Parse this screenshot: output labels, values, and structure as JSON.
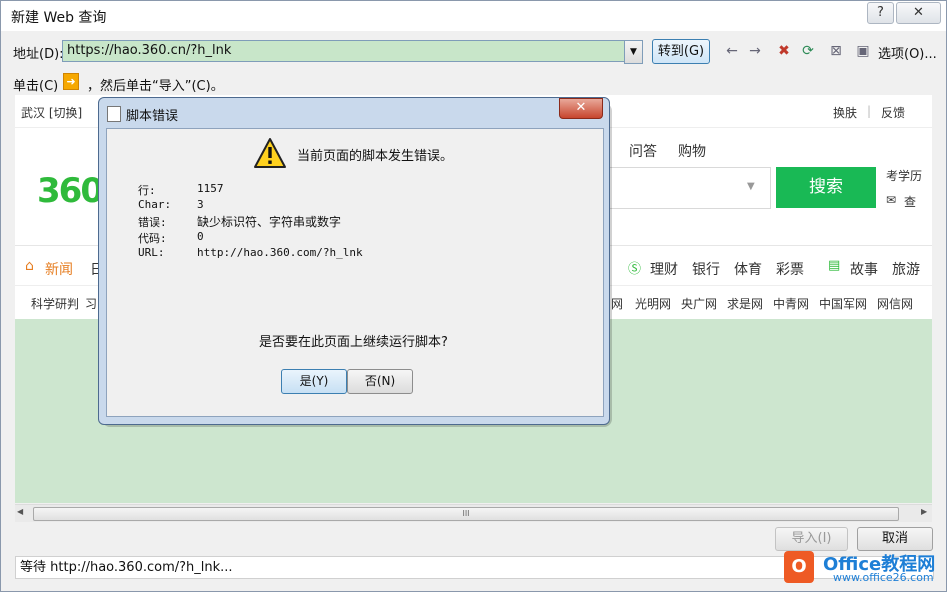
{
  "window": {
    "title": "新建 Web 查询",
    "help_label": "?",
    "close_label": "✕"
  },
  "address": {
    "label": "地址(D):",
    "value": "https://hao.360.cn/?h_lnk",
    "go_label": "转到(G)",
    "options_label": "选项(O)..."
  },
  "hint": {
    "prefix": "单击(C)",
    "suffix": "，然后单击“导入”(C)。"
  },
  "page": {
    "location": "武汉 [切换]",
    "top_right": [
      "换肤",
      "|",
      "反馈"
    ],
    "logo": "360",
    "nav_tabs": [
      "问答",
      "购物"
    ],
    "search_button": "搜索",
    "search_side_1": "考学历",
    "search_side_2": "查",
    "news": "新闻",
    "news_short": "日",
    "categories": [
      "理财",
      "银行",
      "体育",
      "彩票",
      "故事",
      "旅游"
    ],
    "links_left": [
      "科学研判",
      "习"
    ],
    "links_right": [
      "网",
      "光明网",
      "央广网",
      "求是网",
      "中青网",
      "中国军网",
      "网信网"
    ]
  },
  "scrollbar": {
    "grip": "III"
  },
  "buttons": {
    "import_label": "导入(I)",
    "cancel_label": "取消"
  },
  "status": {
    "text": "等待 http://hao.360.com/?h_lnk..."
  },
  "watermark": {
    "title": "Office教程网",
    "url": "www.office26.com"
  },
  "dialog": {
    "title": "脚本错误",
    "heading": "当前页面的脚本发生错误。",
    "rows": [
      {
        "label": "行:",
        "value": "1157"
      },
      {
        "label": "Char:",
        "value": "3"
      },
      {
        "label": "错误:",
        "value": "缺少标识符、字符串或数字"
      },
      {
        "label": "代码:",
        "value": "0"
      },
      {
        "label": "URL:",
        "value": "http://hao.360.com/?h_lnk"
      }
    ],
    "question": "是否要在此页面上继续运行脚本?",
    "yes_label": "是(Y)",
    "no_label": "否(N)"
  }
}
